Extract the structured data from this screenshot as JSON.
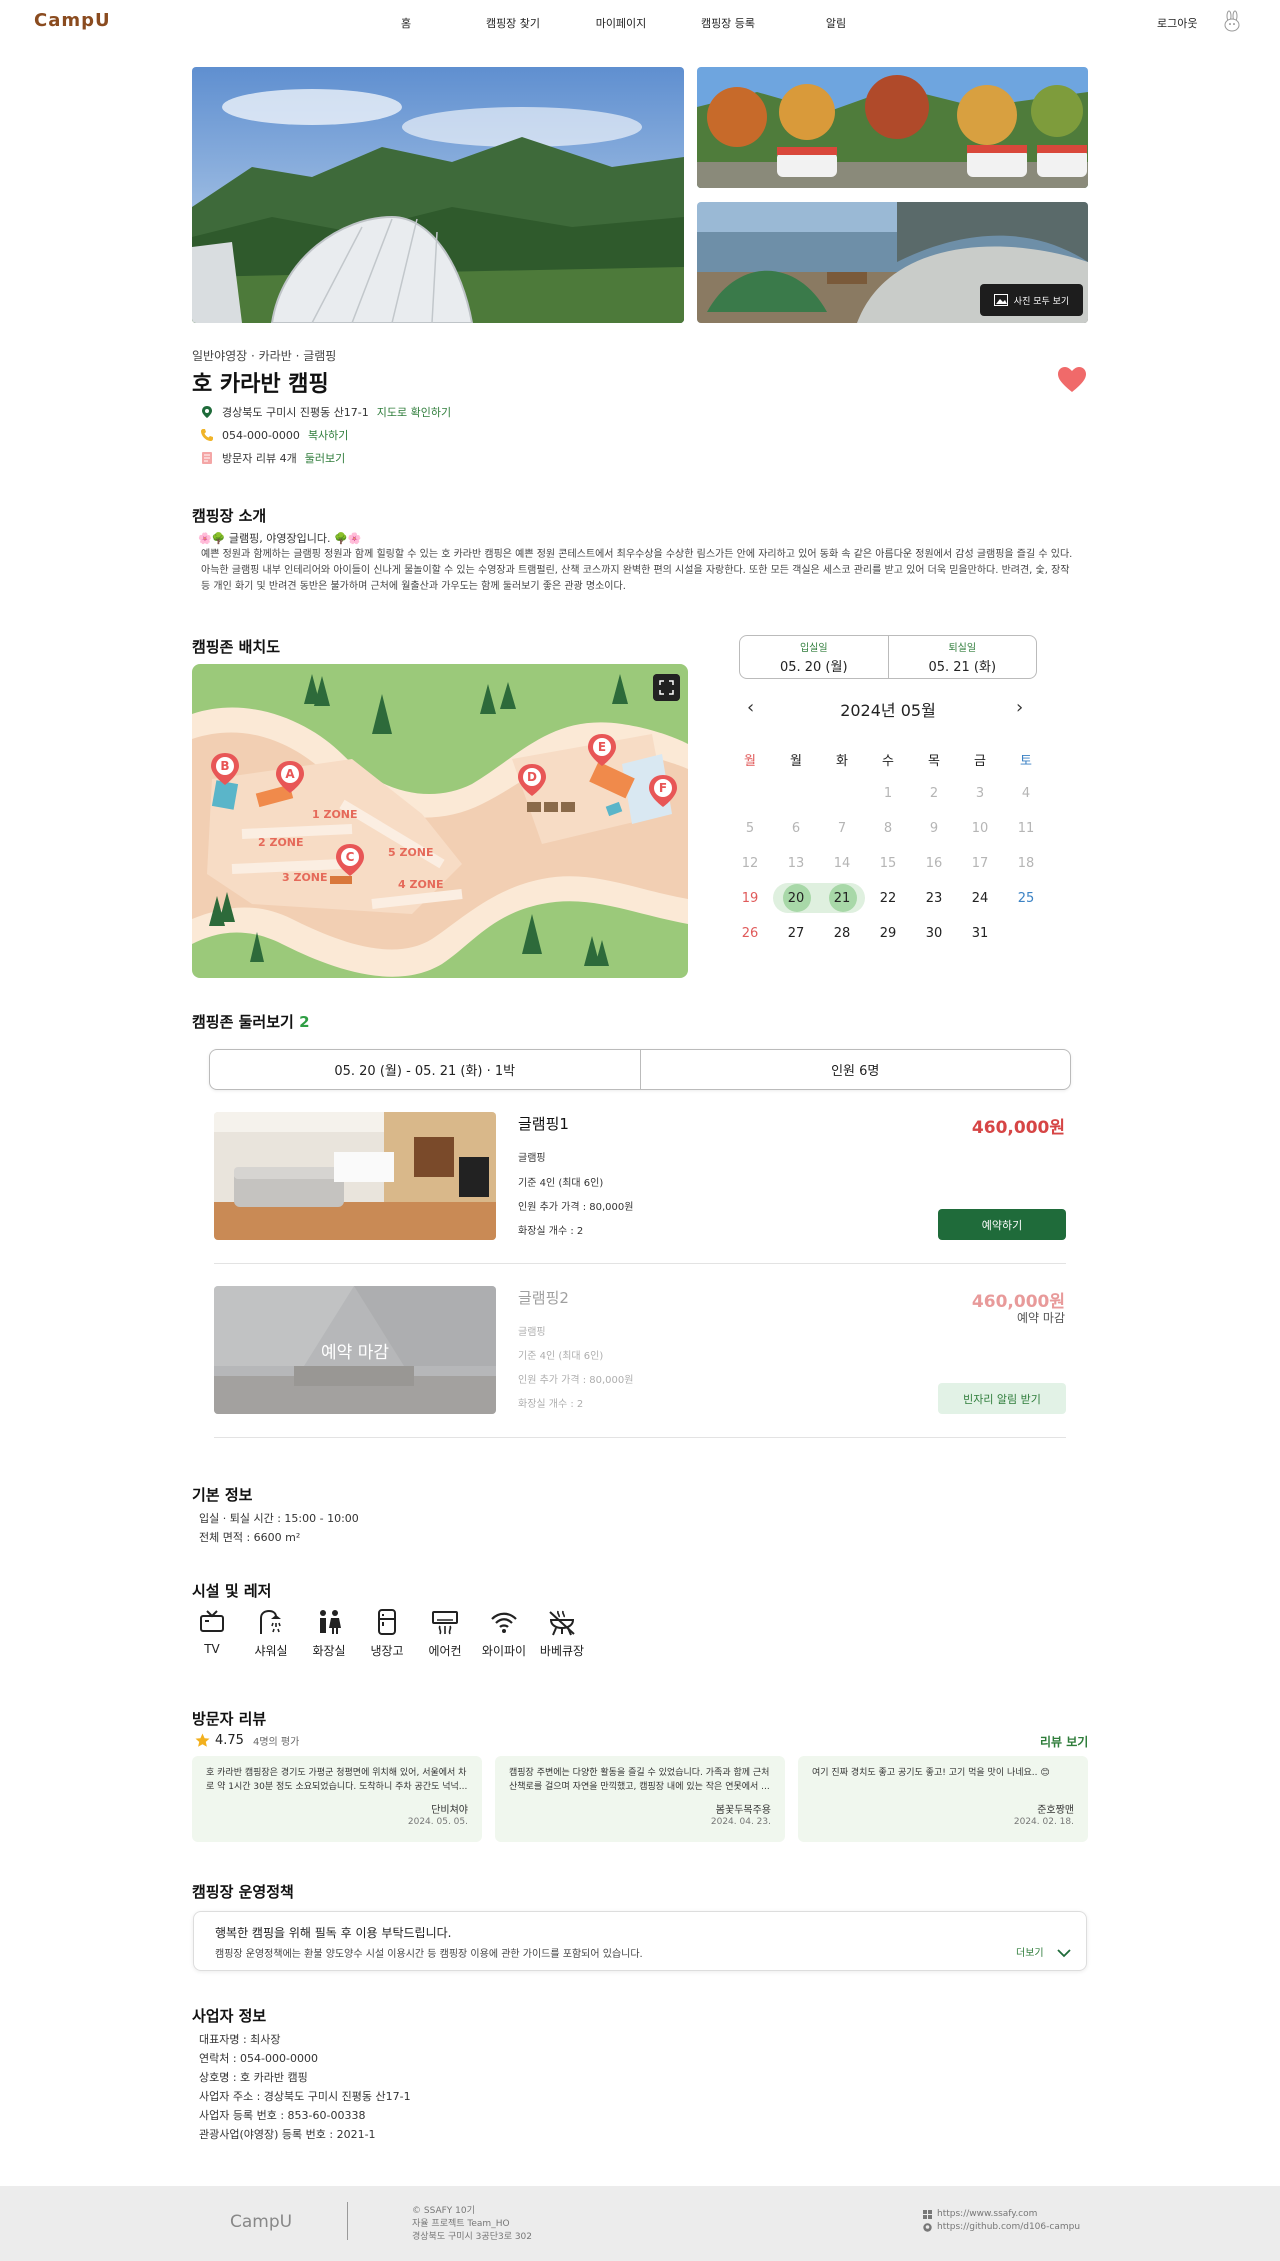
{
  "header": {
    "logo": "CampU",
    "nav": [
      "홈",
      "캠핑장 찾기",
      "마이페이지",
      "캠핑장 등록",
      "알림"
    ],
    "logout": "로그아웃"
  },
  "gallery": {
    "all_photos_label": "사진 모두 보기"
  },
  "camp": {
    "categories": "일반야영장 · 카라반 · 글램핑",
    "name": "호 카라반 캠핑",
    "address": "경상북도 구미시 진평동 산17-1",
    "address_link": "지도로 확인하기",
    "phone": "054-000-0000",
    "phone_link": "복사하기",
    "reviews_count": "방문자 리뷰 4개",
    "reviews_link": "둘러보기"
  },
  "intro": {
    "title": "캠핑장 소개",
    "line1": "🌸🌳 글램핑, 야영장입니다. 🌳🌸",
    "body": "예쁜 정원과 함께하는 글램핑 정원과 함께 힐링할 수 있는 호 카라반 캠핑은 예쁜 정원 콘테스트에서 최우수상을 수상한 림스가든 안에 자리하고 있어 동화 속 같은 아름다운 정원에서 감성 글램핑을 즐길 수 있다. 아늑한 글램핑 내부 인테리어와 아이들이 신나게 물놀이할 수 있는 수영장과 트램펄린, 산책 코스까지 완벽한 편의 시설을 자랑한다. 또한 모든 객실은 세스코 관리를 받고 있어 더욱 믿을만하다. 반려견, 숯, 장작 등 개인 화기 및 반려견 동반은 불가하며 근처에 월출산과 가우도는 함께 둘러보기 좋은 관광 명소이다."
  },
  "layout_map": {
    "title": "캠핑존 배치도",
    "markers": [
      "A",
      "B",
      "C",
      "D",
      "E",
      "F"
    ],
    "zones": [
      "1 ZONE",
      "2 ZONE",
      "3 ZONE",
      "4 ZONE",
      "5 ZONE"
    ]
  },
  "calendar": {
    "checkin_label": "입실일",
    "checkin_value": "05. 20 (월)",
    "checkout_label": "퇴실일",
    "checkout_value": "05. 21 (화)",
    "month": "2024년 05월",
    "weekdays": [
      "월",
      "월",
      "화",
      "수",
      "목",
      "금",
      "토"
    ],
    "weeks": [
      [
        "",
        "",
        "",
        "1",
        "2",
        "3",
        "4"
      ],
      [
        "5",
        "6",
        "7",
        "8",
        "9",
        "10",
        "11"
      ],
      [
        "12",
        "13",
        "14",
        "15",
        "16",
        "17",
        "18"
      ],
      [
        "19",
        "20",
        "21",
        "22",
        "23",
        "24",
        "25"
      ],
      [
        "26",
        "27",
        "28",
        "29",
        "30",
        "31",
        ""
      ]
    ],
    "selected": [
      "20",
      "21"
    ]
  },
  "zones_section": {
    "title": "캠핑존 둘러보기",
    "count": "2",
    "date_range": "05. 20 (월) - 05. 21 (화) · 1박",
    "guests": "인원 6명",
    "rooms": [
      {
        "name": "글램핑1",
        "price": "460,000원",
        "type": "글램핑",
        "capacity": "기준 4인 (최대 6인)",
        "extra": "인원 추가 가격 : 80,000원",
        "toilets": "화장실 개수 : 2",
        "button": "예약하기",
        "closed_label": ""
      },
      {
        "name": "글램핑2",
        "price": "460,000원",
        "type": "글램핑",
        "capacity": "기준 4인 (최대 6인)",
        "extra": "인원 추가 가격 : 80,000원",
        "toilets": "화장실 개수 : 2",
        "button": "빈자리 알림 받기",
        "closed_label": "예약 마감",
        "overlay": "예약 마감"
      }
    ]
  },
  "basic_info": {
    "title": "기본 정보",
    "checkin_time": "입실 · 퇴실 시간 : 15:00 - 10:00",
    "area": "전체 면적 : 6600 m²"
  },
  "facilities": {
    "title": "시설 및 레저",
    "items": [
      {
        "label": "TV",
        "icon": "tv-icon"
      },
      {
        "label": "샤워실",
        "icon": "shower-icon"
      },
      {
        "label": "화장실",
        "icon": "restroom-icon"
      },
      {
        "label": "냉장고",
        "icon": "fridge-icon"
      },
      {
        "label": "에어컨",
        "icon": "aircon-icon"
      },
      {
        "label": "와이파이",
        "icon": "wifi-icon"
      },
      {
        "label": "바베큐장",
        "icon": "bbq-icon"
      }
    ]
  },
  "reviews": {
    "title": "방문자 리뷰",
    "rating": "4.75",
    "rating_count": "4명의 평가",
    "see_all": "리뷰 보기",
    "items": [
      {
        "text": "호 카라반 캠핑장은 경기도 가평군 청평면에 위치해 있어, 서울에서 차로 약 1시간 30분 정도 소요되었습니다. 도착하니 주차 공간도 넉넉...",
        "author": "단비쳐야",
        "date": "2024. 05. 05."
      },
      {
        "text": "캠핑장 주변에는 다양한 활동을 즐길 수 있었습니다. 가족과 함께 근처 산책로를 걸으며 자연을 만끽했고, 캠핑장 내에 있는 작은 연못에서 ...",
        "author": "봄꽃두목주용",
        "date": "2024. 04. 23."
      },
      {
        "text": "여기 진짜 경치도 좋고 공기도 좋고! 고기 먹을 맛이 나네요.. 😊",
        "author": "준호짱맨",
        "date": "2024. 02. 18."
      }
    ]
  },
  "policy": {
    "title": "캠핑장 운영정책",
    "line1": "행복한 캠핑을 위해 필독 후 이용 부탁드립니다.",
    "line2": "캠핑장 운영정책에는 환불 양도양수 시설 이용시간 등 캠핑장 이용에 관한 가이드를 포함되어 있습니다.",
    "more": "더보기"
  },
  "business": {
    "title": "사업자 정보",
    "lines": [
      "대표자명 :  최사장",
      "연락처 :  054-000-0000",
      "상호명 :  호 카라반 캠핑",
      "사업자 주소 : 경상북도 구미시 진평동 산17-1",
      "사업자 등록 번호 : 853-60-00338",
      "관광사업(야영장) 등록 번호 : 2021-1"
    ]
  },
  "footer": {
    "logo": "CampU",
    "left": [
      "© SSAFY 10기",
      "자율 프로젝트 Team_HO",
      "경상북도 구미시 3공단3로 302"
    ],
    "right": [
      "https://www.ssafy.com",
      "https://github.com/d106-campu"
    ]
  },
  "colors": {
    "brand": "#8a4b1f",
    "green": "#1f6b3a",
    "accent_red": "#d64545",
    "heart": "#f06a6a"
  }
}
